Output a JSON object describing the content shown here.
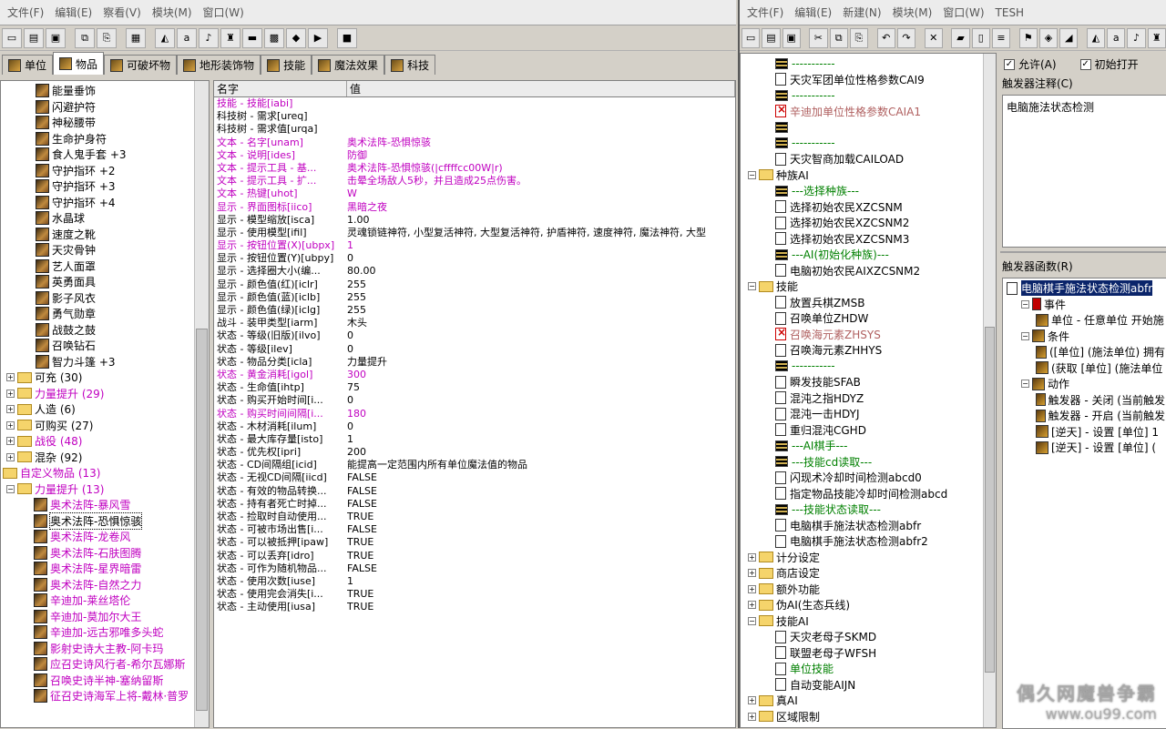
{
  "object_editor": {
    "menu": [
      "文件(F)",
      "编辑(E)",
      "察看(V)",
      "模块(M)",
      "窗口(W)"
    ],
    "tabs": [
      "单位",
      "物品",
      "可破坏物",
      "地形装饰物",
      "技能",
      "魔法效果",
      "科技"
    ],
    "active_tab": "物品",
    "tree": [
      {
        "type": "item",
        "label": "能量垂饰",
        "indent": 2
      },
      {
        "type": "item",
        "label": "闪避护符",
        "indent": 2
      },
      {
        "type": "item",
        "label": "神秘腰带",
        "indent": 2
      },
      {
        "type": "item",
        "label": "生命护身符",
        "indent": 2
      },
      {
        "type": "item",
        "label": "食人鬼手套 +3",
        "indent": 2
      },
      {
        "type": "item",
        "label": "守护指环 +2",
        "indent": 2
      },
      {
        "type": "item",
        "label": "守护指环 +3",
        "indent": 2
      },
      {
        "type": "item",
        "label": "守护指环 +4",
        "indent": 2
      },
      {
        "type": "item",
        "label": "水晶球",
        "indent": 2
      },
      {
        "type": "item",
        "label": "速度之靴",
        "indent": 2
      },
      {
        "type": "item",
        "label": "天灾骨钟",
        "indent": 2
      },
      {
        "type": "item",
        "label": "艺人面罩",
        "indent": 2
      },
      {
        "type": "item",
        "label": "英勇面具",
        "indent": 2
      },
      {
        "type": "item",
        "label": "影子风衣",
        "indent": 2
      },
      {
        "type": "item",
        "label": "勇气勋章",
        "indent": 2
      },
      {
        "type": "item",
        "label": "战鼓之鼓",
        "indent": 2
      },
      {
        "type": "item",
        "label": "召唤钻石",
        "indent": 2
      },
      {
        "type": "item",
        "label": "智力斗篷 +3",
        "indent": 2
      },
      {
        "type": "folder",
        "label": "可充 (30)",
        "indent": 0
      },
      {
        "type": "folder",
        "label": "力量提升 (29)",
        "indent": 0,
        "purple": true
      },
      {
        "type": "folder",
        "label": "人造 (6)",
        "indent": 0
      },
      {
        "type": "folder",
        "label": "可购买 (27)",
        "indent": 0
      },
      {
        "type": "folder",
        "label": "战役 (48)",
        "indent": 0,
        "purple": true
      },
      {
        "type": "folder",
        "label": "混杂 (92)",
        "indent": 0
      },
      {
        "type": "folder",
        "label": "自定义物品 (13)",
        "indent": -1,
        "purple": true
      },
      {
        "type": "folder",
        "label": "力量提升 (13)",
        "indent": 0,
        "purple": true
      },
      {
        "type": "item",
        "label": "奥术法阵-暴风雪",
        "indent": 1,
        "purple": true
      },
      {
        "type": "item",
        "label": "奥术法阵-恐惧惊骇",
        "indent": 1,
        "selected": true
      },
      {
        "type": "item",
        "label": "奥术法阵-龙卷风",
        "indent": 1,
        "purple": true
      },
      {
        "type": "item",
        "label": "奥术法阵-石肤图腾",
        "indent": 1,
        "purple": true
      },
      {
        "type": "item",
        "label": "奥术法阵-星界暗雷",
        "indent": 1,
        "purple": true
      },
      {
        "type": "item",
        "label": "奥术法阵-自然之力",
        "indent": 1,
        "purple": true
      },
      {
        "type": "item",
        "label": "辛迪加-莱丝塔伦",
        "indent": 1,
        "purple": true
      },
      {
        "type": "item",
        "label": "辛迪加-莫加尔大王",
        "indent": 1,
        "purple": true
      },
      {
        "type": "item",
        "label": "辛迪加-远古邪唯多头蛇",
        "indent": 1,
        "purple": true
      },
      {
        "type": "item",
        "label": "影射史诗大主教-阿卡玛",
        "indent": 1,
        "purple": true
      },
      {
        "type": "item",
        "label": "应召史诗风行者-希尔瓦娜斯",
        "indent": 1,
        "purple": true
      },
      {
        "type": "item",
        "label": "召唤史诗半神-塞纳留斯",
        "indent": 1,
        "purple": true
      },
      {
        "type": "item",
        "label": "征召史诗海军上将-戴林·普罗",
        "indent": 1,
        "purple": true
      }
    ],
    "grid_headers": {
      "name": "名字",
      "value": "值"
    },
    "properties": [
      {
        "k": "技能 - 技能[iabi]",
        "v": "",
        "p": true
      },
      {
        "k": "科技树 - 需求[ureq]",
        "v": ""
      },
      {
        "k": "科技树 - 需求值[urqa]",
        "v": ""
      },
      {
        "k": "文本 - 名字[unam]",
        "v": "奥术法阵-恐惧惊骇",
        "p": true
      },
      {
        "k": "文本 - 说明[ides]",
        "v": "防御",
        "p": true
      },
      {
        "k": "文本 - 提示工具 - 基...",
        "v": "奥术法阵-恐惧惊骇(|cffffcc00W|r)",
        "p": true
      },
      {
        "k": "文本 - 提示工具 - 扩...",
        "v": "击晕全场敌人5秒，并且造成25点伤害。",
        "p": true
      },
      {
        "k": "文本 - 热键[uhot]",
        "v": "W",
        "p": true
      },
      {
        "k": "显示 - 界面图标[iico]",
        "v": "黑暗之夜",
        "p": true
      },
      {
        "k": "显示 - 模型缩放[isca]",
        "v": "1.00"
      },
      {
        "k": "显示 - 使用模型[ifil]",
        "v": "灵魂锁链神符, 小型复活神符, 大型复活神符, 护盾神符, 速度神符, 魔法神符, 大型"
      },
      {
        "k": "显示 - 按钮位置(X)[ubpx]",
        "v": "1",
        "p": true
      },
      {
        "k": "显示 - 按钮位置(Y)[ubpy]",
        "v": "0"
      },
      {
        "k": "显示 - 选择圈大小(编...",
        "v": "80.00"
      },
      {
        "k": "显示 - 颜色值(红)[iclr]",
        "v": "255"
      },
      {
        "k": "显示 - 颜色值(蓝)[iclb]",
        "v": "255"
      },
      {
        "k": "显示 - 颜色值(绿)[iclg]",
        "v": "255"
      },
      {
        "k": "战斗 - 装甲类型[iarm]",
        "v": "木头"
      },
      {
        "k": "状态 - 等级(旧版)[ilvo]",
        "v": "0"
      },
      {
        "k": "状态 - 等级[ilev]",
        "v": "0"
      },
      {
        "k": "状态 - 物品分类[icla]",
        "v": "力量提升"
      },
      {
        "k": "状态 - 黄金消耗[igol]",
        "v": "300",
        "p": true
      },
      {
        "k": "状态 - 生命值[ihtp]",
        "v": "75"
      },
      {
        "k": "状态 - 购买开始时间[i...",
        "v": "0"
      },
      {
        "k": "状态 - 购买时间间隔[i...",
        "v": "180",
        "p": true
      },
      {
        "k": "状态 - 木材消耗[ilum]",
        "v": "0"
      },
      {
        "k": "状态 - 最大库存量[isto]",
        "v": "1"
      },
      {
        "k": "状态 - 优先权[ipri]",
        "v": "200"
      },
      {
        "k": "状态 - CD间隔组[icid]",
        "v": "能提高一定范围内所有单位魔法值的物品"
      },
      {
        "k": "状态 - 无视CD间隔[iicd]",
        "v": "FALSE"
      },
      {
        "k": "状态 - 有效的物品转换...",
        "v": "FALSE"
      },
      {
        "k": "状态 - 持有者死亡时掉...",
        "v": "FALSE"
      },
      {
        "k": "状态 - 捡取时自动使用...",
        "v": "TRUE"
      },
      {
        "k": "状态 - 可被市场出售[i...",
        "v": "FALSE"
      },
      {
        "k": "状态 - 可以被抵押[ipaw]",
        "v": "TRUE"
      },
      {
        "k": "状态 - 可以丢弃[idro]",
        "v": "TRUE"
      },
      {
        "k": "状态 - 可作为随机物品...",
        "v": "FALSE"
      },
      {
        "k": "状态 - 使用次数[iuse]",
        "v": "1"
      },
      {
        "k": "状态 - 使用完会消失[i...",
        "v": "TRUE"
      },
      {
        "k": "状态 - 主动使用[iusa]",
        "v": "TRUE"
      }
    ]
  },
  "trigger_editor": {
    "menu": [
      "文件(F)",
      "编辑(E)",
      "新建(N)",
      "模块(M)",
      "窗口(W)",
      "TESH"
    ],
    "tree": [
      {
        "t": "comment",
        "label": "-----------",
        "indent": 2,
        "g": true
      },
      {
        "t": "trig",
        "label": "天灾军团单位性格参数CAI9",
        "indent": 2
      },
      {
        "t": "comment",
        "label": "-----------",
        "indent": 2,
        "g": true
      },
      {
        "t": "trigx",
        "label": "辛迪加单位性格参数CAIA1",
        "indent": 2,
        "r": true
      },
      {
        "t": "comment",
        "label": "",
        "indent": 2
      },
      {
        "t": "comment",
        "label": "-----------",
        "indent": 2,
        "g": true
      },
      {
        "t": "trig",
        "label": "天灾智商加载CAILOAD",
        "indent": 2
      },
      {
        "t": "folder",
        "label": "种族AI",
        "indent": 0
      },
      {
        "t": "comment",
        "label": "---选择种族---",
        "indent": 2,
        "g": true
      },
      {
        "t": "trig",
        "label": "选择初始农民XZCSNM",
        "indent": 2
      },
      {
        "t": "trig",
        "label": "选择初始农民XZCSNM2",
        "indent": 2
      },
      {
        "t": "trig",
        "label": "选择初始农民XZCSNM3",
        "indent": 2
      },
      {
        "t": "comment",
        "label": "---AI(初始化种族)---",
        "indent": 2,
        "g": true
      },
      {
        "t": "trig",
        "label": "电脑初始农民AIXZCSNM2",
        "indent": 2
      },
      {
        "t": "folder",
        "label": "技能",
        "indent": 0
      },
      {
        "t": "trig",
        "label": "放置兵棋ZMSB",
        "indent": 2
      },
      {
        "t": "trig",
        "label": "召唤单位ZHDW",
        "indent": 2
      },
      {
        "t": "trigx",
        "label": "召唤海元素ZHSYS",
        "indent": 2,
        "r": true
      },
      {
        "t": "trig",
        "label": "召唤海元素ZHHYS",
        "indent": 2
      },
      {
        "t": "comment",
        "label": "-----------",
        "indent": 2,
        "g": true
      },
      {
        "t": "trig",
        "label": "瞬发技能SFAB",
        "indent": 2
      },
      {
        "t": "trig",
        "label": "混沌之指HDYZ",
        "indent": 2
      },
      {
        "t": "trig",
        "label": "混沌一击HDYJ",
        "indent": 2
      },
      {
        "t": "trig",
        "label": "重归混沌CGHD",
        "indent": 2
      },
      {
        "t": "comment",
        "label": "---AI棋手---",
        "indent": 2,
        "g": true
      },
      {
        "t": "comment",
        "label": "---技能cd读取---",
        "indent": 2,
        "g": true
      },
      {
        "t": "trig",
        "label": "闪现术冷却时间检测abcd0",
        "indent": 2
      },
      {
        "t": "trig",
        "label": "指定物品技能冷却时间检测abcd",
        "indent": 2
      },
      {
        "t": "comment",
        "label": "---技能状态读取---",
        "indent": 2,
        "g": true
      },
      {
        "t": "trig",
        "label": "电脑棋手施法状态检测abfr",
        "indent": 2
      },
      {
        "t": "trig",
        "label": "电脑棋手施法状态检测abfr2",
        "indent": 2
      },
      {
        "t": "folder",
        "label": "计分设定",
        "indent": 0,
        "c": true
      },
      {
        "t": "folder",
        "label": "商店设定",
        "indent": 0,
        "c": true
      },
      {
        "t": "folder",
        "label": "额外功能",
        "indent": 0,
        "c": true
      },
      {
        "t": "folder",
        "label": "伪AI(生态兵线)",
        "indent": 0,
        "c": true
      },
      {
        "t": "folder",
        "label": "技能AI",
        "indent": 0
      },
      {
        "t": "trig",
        "label": "天灾老母子SKMD",
        "indent": 2
      },
      {
        "t": "trig",
        "label": "联盟老母子WFSH",
        "indent": 2
      },
      {
        "t": "trig",
        "label": "单位技能",
        "indent": 2,
        "g": true
      },
      {
        "t": "trig",
        "label": "自动变能AIJN",
        "indent": 2
      },
      {
        "t": "folder",
        "label": "真AI",
        "indent": 0,
        "c": true
      },
      {
        "t": "folder",
        "label": "区域限制",
        "indent": 0,
        "c": true
      }
    ],
    "options": {
      "enabled": "允许(A)",
      "initially_on": "初始打开"
    },
    "comment_label": "触发器注释(C)",
    "comment_text": "电脑施法状态检测",
    "function_label": "触发器函数(R)",
    "functions": [
      {
        "label": "电脑棋手施法状态检测abfr",
        "kind": "trigger",
        "indent": 0
      },
      {
        "label": "事件",
        "kind": "events",
        "indent": 1
      },
      {
        "label": "单位 - 任意单位 开始施",
        "kind": "event",
        "indent": 2
      },
      {
        "label": "条件",
        "kind": "conditions",
        "indent": 1
      },
      {
        "label": "([单位] (施法单位) 拥有",
        "kind": "cond",
        "indent": 2
      },
      {
        "label": "(获取 [单位] (施法单位",
        "kind": "cond",
        "indent": 2
      },
      {
        "label": "动作",
        "kind": "actions",
        "indent": 1
      },
      {
        "label": "触发器 - 关闭 (当前触发",
        "kind": "act",
        "indent": 2
      },
      {
        "label": "触发器 - 开启 (当前触发",
        "kind": "act",
        "indent": 2
      },
      {
        "label": "[逆天] - 设置 [单位] 1",
        "kind": "act",
        "indent": 2
      },
      {
        "label": "[逆天] - 设置 [单位] (",
        "kind": "act",
        "indent": 2
      }
    ],
    "watermark": {
      "line1": "偶久网魔兽争霸",
      "line2": "www.ou99.com"
    }
  }
}
